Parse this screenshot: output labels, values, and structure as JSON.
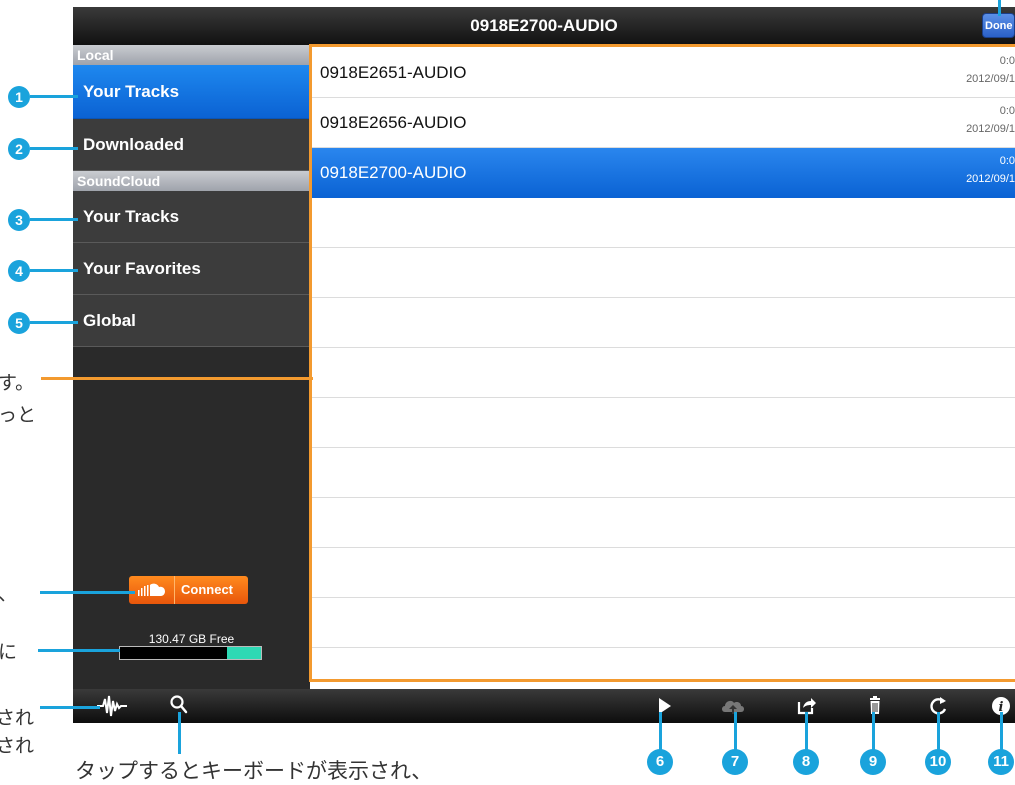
{
  "window": {
    "title": "0918E2700-AUDIO",
    "done_label": "Done"
  },
  "sidebar": {
    "local_header": "Local",
    "local_items": [
      {
        "label": "Your Tracks",
        "selected": true
      },
      {
        "label": "Downloaded",
        "selected": false
      }
    ],
    "soundcloud_header": "SoundCloud",
    "soundcloud_items": [
      {
        "label": "Your Tracks"
      },
      {
        "label": "Your Favorites"
      },
      {
        "label": "Global"
      }
    ],
    "connect_label": "Connect",
    "storage_free": "130.47 GB Free",
    "storage_used_fraction": 0.76
  },
  "tracks": [
    {
      "name": "0918E2651-AUDIO",
      "duration": "0:0",
      "date": "2012/09/1",
      "selected": false
    },
    {
      "name": "0918E2656-AUDIO",
      "duration": "0:0",
      "date": "2012/09/1",
      "selected": false
    },
    {
      "name": "0918E2700-AUDIO",
      "duration": "0:0",
      "date": "2012/09/1",
      "selected": true
    }
  ],
  "toolbar": {
    "left_icons": [
      "waveform-icon",
      "search-icon"
    ],
    "right_icons": [
      "play-icon",
      "cloud-upload-icon",
      "share-icon",
      "trash-icon",
      "refresh-icon",
      "info-icon"
    ]
  },
  "callouts": {
    "badges": [
      "1",
      "2",
      "3",
      "4",
      "5",
      "6",
      "7",
      "8",
      "9",
      "10",
      "11"
    ],
    "accent_color": "#1aa3dc",
    "frame_color": "#f39a2f"
  },
  "annotations": {
    "jp_list_1": "す。",
    "jp_list_2": "っと",
    "jp_connect": "、",
    "jp_storage": "に",
    "jp_wave_1": "され",
    "jp_wave_2": "され",
    "jp_search": "タップするとキーボードが表示され、"
  },
  "colors": {
    "selection_blue": "#0b63d4",
    "soundcloud_orange": "#f26f10",
    "storage_fill": "#2ed9b4"
  }
}
